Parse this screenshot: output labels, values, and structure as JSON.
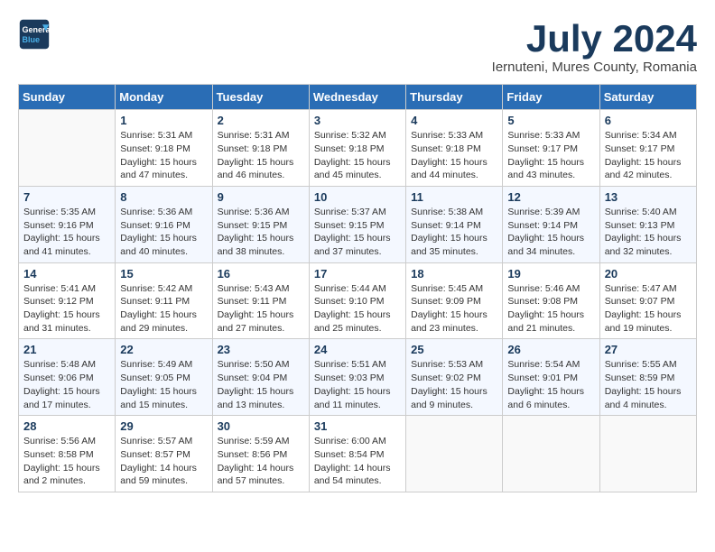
{
  "header": {
    "logo_line1": "General",
    "logo_line2": "Blue",
    "month": "July 2024",
    "location": "Iernuteni, Mures County, Romania"
  },
  "weekdays": [
    "Sunday",
    "Monday",
    "Tuesday",
    "Wednesday",
    "Thursday",
    "Friday",
    "Saturday"
  ],
  "weeks": [
    [
      {
        "day": "",
        "info": ""
      },
      {
        "day": "1",
        "info": "Sunrise: 5:31 AM\nSunset: 9:18 PM\nDaylight: 15 hours\nand 47 minutes."
      },
      {
        "day": "2",
        "info": "Sunrise: 5:31 AM\nSunset: 9:18 PM\nDaylight: 15 hours\nand 46 minutes."
      },
      {
        "day": "3",
        "info": "Sunrise: 5:32 AM\nSunset: 9:18 PM\nDaylight: 15 hours\nand 45 minutes."
      },
      {
        "day": "4",
        "info": "Sunrise: 5:33 AM\nSunset: 9:18 PM\nDaylight: 15 hours\nand 44 minutes."
      },
      {
        "day": "5",
        "info": "Sunrise: 5:33 AM\nSunset: 9:17 PM\nDaylight: 15 hours\nand 43 minutes."
      },
      {
        "day": "6",
        "info": "Sunrise: 5:34 AM\nSunset: 9:17 PM\nDaylight: 15 hours\nand 42 minutes."
      }
    ],
    [
      {
        "day": "7",
        "info": "Sunrise: 5:35 AM\nSunset: 9:16 PM\nDaylight: 15 hours\nand 41 minutes."
      },
      {
        "day": "8",
        "info": "Sunrise: 5:36 AM\nSunset: 9:16 PM\nDaylight: 15 hours\nand 40 minutes."
      },
      {
        "day": "9",
        "info": "Sunrise: 5:36 AM\nSunset: 9:15 PM\nDaylight: 15 hours\nand 38 minutes."
      },
      {
        "day": "10",
        "info": "Sunrise: 5:37 AM\nSunset: 9:15 PM\nDaylight: 15 hours\nand 37 minutes."
      },
      {
        "day": "11",
        "info": "Sunrise: 5:38 AM\nSunset: 9:14 PM\nDaylight: 15 hours\nand 35 minutes."
      },
      {
        "day": "12",
        "info": "Sunrise: 5:39 AM\nSunset: 9:14 PM\nDaylight: 15 hours\nand 34 minutes."
      },
      {
        "day": "13",
        "info": "Sunrise: 5:40 AM\nSunset: 9:13 PM\nDaylight: 15 hours\nand 32 minutes."
      }
    ],
    [
      {
        "day": "14",
        "info": "Sunrise: 5:41 AM\nSunset: 9:12 PM\nDaylight: 15 hours\nand 31 minutes."
      },
      {
        "day": "15",
        "info": "Sunrise: 5:42 AM\nSunset: 9:11 PM\nDaylight: 15 hours\nand 29 minutes."
      },
      {
        "day": "16",
        "info": "Sunrise: 5:43 AM\nSunset: 9:11 PM\nDaylight: 15 hours\nand 27 minutes."
      },
      {
        "day": "17",
        "info": "Sunrise: 5:44 AM\nSunset: 9:10 PM\nDaylight: 15 hours\nand 25 minutes."
      },
      {
        "day": "18",
        "info": "Sunrise: 5:45 AM\nSunset: 9:09 PM\nDaylight: 15 hours\nand 23 minutes."
      },
      {
        "day": "19",
        "info": "Sunrise: 5:46 AM\nSunset: 9:08 PM\nDaylight: 15 hours\nand 21 minutes."
      },
      {
        "day": "20",
        "info": "Sunrise: 5:47 AM\nSunset: 9:07 PM\nDaylight: 15 hours\nand 19 minutes."
      }
    ],
    [
      {
        "day": "21",
        "info": "Sunrise: 5:48 AM\nSunset: 9:06 PM\nDaylight: 15 hours\nand 17 minutes."
      },
      {
        "day": "22",
        "info": "Sunrise: 5:49 AM\nSunset: 9:05 PM\nDaylight: 15 hours\nand 15 minutes."
      },
      {
        "day": "23",
        "info": "Sunrise: 5:50 AM\nSunset: 9:04 PM\nDaylight: 15 hours\nand 13 minutes."
      },
      {
        "day": "24",
        "info": "Sunrise: 5:51 AM\nSunset: 9:03 PM\nDaylight: 15 hours\nand 11 minutes."
      },
      {
        "day": "25",
        "info": "Sunrise: 5:53 AM\nSunset: 9:02 PM\nDaylight: 15 hours\nand 9 minutes."
      },
      {
        "day": "26",
        "info": "Sunrise: 5:54 AM\nSunset: 9:01 PM\nDaylight: 15 hours\nand 6 minutes."
      },
      {
        "day": "27",
        "info": "Sunrise: 5:55 AM\nSunset: 8:59 PM\nDaylight: 15 hours\nand 4 minutes."
      }
    ],
    [
      {
        "day": "28",
        "info": "Sunrise: 5:56 AM\nSunset: 8:58 PM\nDaylight: 15 hours\nand 2 minutes."
      },
      {
        "day": "29",
        "info": "Sunrise: 5:57 AM\nSunset: 8:57 PM\nDaylight: 14 hours\nand 59 minutes."
      },
      {
        "day": "30",
        "info": "Sunrise: 5:59 AM\nSunset: 8:56 PM\nDaylight: 14 hours\nand 57 minutes."
      },
      {
        "day": "31",
        "info": "Sunrise: 6:00 AM\nSunset: 8:54 PM\nDaylight: 14 hours\nand 54 minutes."
      },
      {
        "day": "",
        "info": ""
      },
      {
        "day": "",
        "info": ""
      },
      {
        "day": "",
        "info": ""
      }
    ]
  ]
}
